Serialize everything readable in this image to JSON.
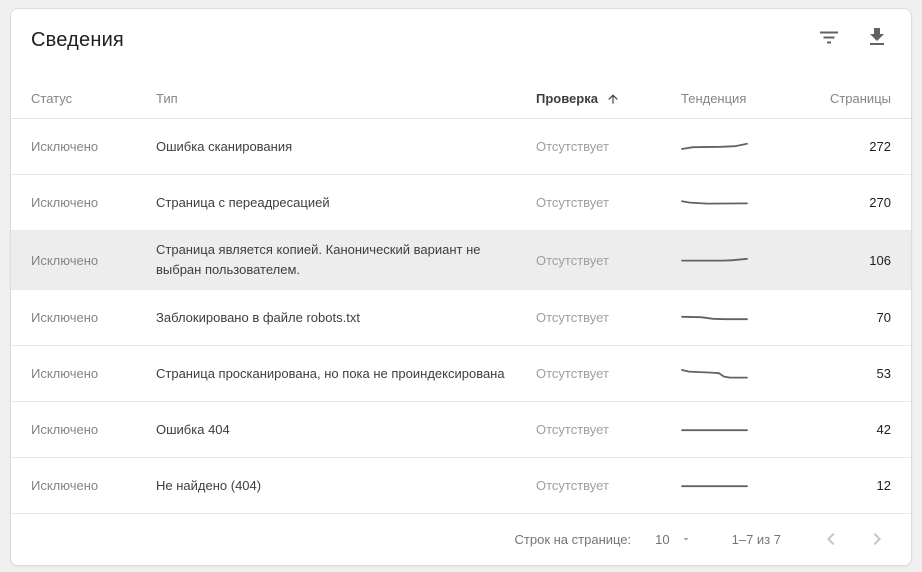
{
  "page": {
    "title": "Сведения"
  },
  "toolbar": {
    "filter_icon": "filter-list-icon",
    "download_icon": "download-icon"
  },
  "table": {
    "columns": {
      "status": "Статус",
      "type": "Тип",
      "validation": "Проверка",
      "sort_direction": "ascending",
      "trend": "Тенденция",
      "pages": "Страницы"
    },
    "rows": [
      {
        "status": "Исключено",
        "type": "Ошибка сканирования",
        "validation": "Отсутствует",
        "pages": 272,
        "highlighted": false,
        "spark": [
          [
            1,
            9
          ],
          [
            12,
            7.2
          ],
          [
            40,
            6.8
          ],
          [
            54,
            6.2
          ],
          [
            66,
            3.8
          ]
        ]
      },
      {
        "status": "Исключено",
        "type": "Страница с переадресацией",
        "validation": "Отсутствует",
        "pages": 270,
        "highlighted": false,
        "spark": [
          [
            1,
            5.2
          ],
          [
            9,
            6.6
          ],
          [
            26,
            7.6
          ],
          [
            66,
            7.4
          ]
        ]
      },
      {
        "status": "Исключено",
        "type": "Страница является копией. Канонический вариант не выбран пользователем.",
        "validation": "Отсутствует",
        "pages": 106,
        "highlighted": true,
        "spark": [
          [
            1,
            7.6
          ],
          [
            42,
            7.6
          ],
          [
            52,
            7.2
          ],
          [
            66,
            5.8
          ]
        ]
      },
      {
        "status": "Исключено",
        "type": "Заблокировано в файле robots.txt",
        "validation": "Отсутствует",
        "pages": 70,
        "highlighted": false,
        "spark": [
          [
            1,
            5.8
          ],
          [
            20,
            6.2
          ],
          [
            32,
            7.8
          ],
          [
            44,
            8.2
          ],
          [
            66,
            8.2
          ]
        ]
      },
      {
        "status": "Исключено",
        "type": "Страница просканирована, но пока не проиндексирована",
        "validation": "Отсутствует",
        "pages": 53,
        "highlighted": false,
        "spark": [
          [
            1,
            3
          ],
          [
            8,
            4.6
          ],
          [
            30,
            5.6
          ],
          [
            38,
            6.2
          ],
          [
            43,
            9.6
          ],
          [
            49,
            10.6
          ],
          [
            66,
            10.6
          ]
        ]
      },
      {
        "status": "Исключено",
        "type": "Ошибка 404",
        "validation": "Отсутствует",
        "pages": 42,
        "highlighted": false,
        "spark": [
          [
            1,
            7.2
          ],
          [
            66,
            7.2
          ]
        ]
      },
      {
        "status": "Исключено",
        "type": "Не найдено (404)",
        "validation": "Отсутствует",
        "pages": 12,
        "highlighted": false,
        "spark": [
          [
            1,
            7.2
          ],
          [
            66,
            7.2
          ]
        ]
      }
    ]
  },
  "footer": {
    "rows_per_page_label": "Строк на странице:",
    "rows_per_page_value": "10",
    "range_label": "1–7 из 7"
  },
  "colors": {
    "sparkline": "#5f6368",
    "highlight_row": "#ededed",
    "header_sorted": "#3c4043",
    "muted_text": "#80868b"
  }
}
